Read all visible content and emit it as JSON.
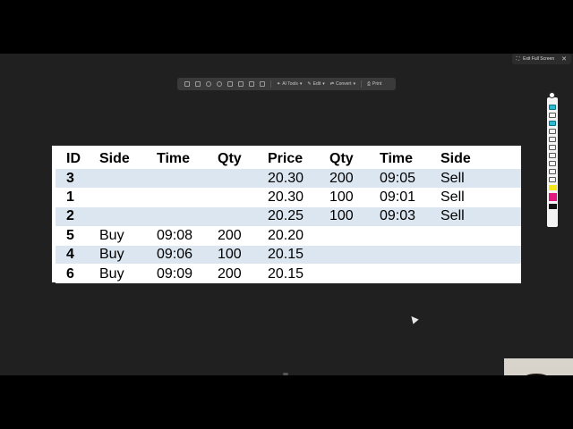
{
  "viewer": {
    "exit_fullscreen_label": "Exit Full Screen",
    "toolbar": {
      "ai_tools_label": "AI Tools",
      "edit_label": "Edit",
      "convert_label": "Convert",
      "print_label": "Print"
    }
  },
  "table": {
    "headers": [
      "ID",
      "Side",
      "Time",
      "Qty",
      "Price",
      "Qty",
      "Time",
      "Side"
    ],
    "rows": [
      [
        "3",
        "",
        "",
        "",
        "20.30",
        "200",
        "09:05",
        "Sell"
      ],
      [
        "1",
        "",
        "",
        "",
        "20.30",
        "100",
        "09:01",
        "Sell"
      ],
      [
        "2",
        "",
        "",
        "",
        "20.25",
        "100",
        "09:03",
        "Sell"
      ],
      [
        "5",
        "Buy",
        "09:08",
        "200",
        "20.20",
        "",
        "",
        ""
      ],
      [
        "4",
        "Buy",
        "09:06",
        "100",
        "20.15",
        "",
        "",
        ""
      ],
      [
        "6",
        "Buy",
        "09:09",
        "200",
        "20.15",
        "",
        "",
        ""
      ]
    ]
  },
  "colors": {
    "row_stripe": "#dbe6f1",
    "annotation_active": "#2bbcd4"
  }
}
